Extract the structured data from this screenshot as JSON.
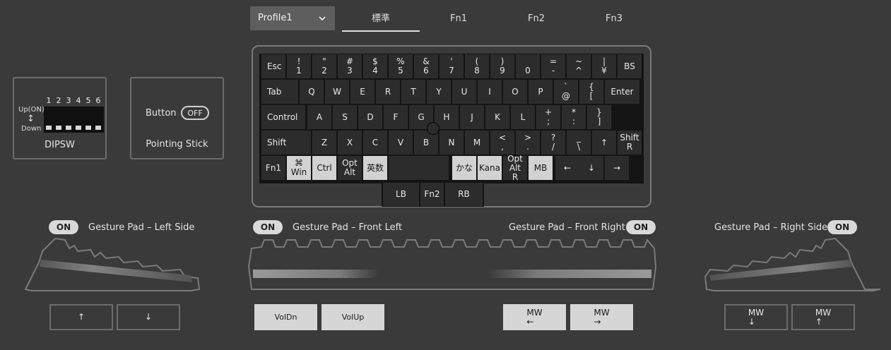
{
  "profile": {
    "selected": "Profile1"
  },
  "tabs": [
    {
      "label": "標準",
      "active": true
    },
    {
      "label": "Fn1",
      "active": false
    },
    {
      "label": "Fn2",
      "active": false
    },
    {
      "label": "Fn3",
      "active": false
    }
  ],
  "dipsw": {
    "title": "DIPSW",
    "up_label": "Up(ON)",
    "arrow": "↕",
    "down_label": "Down",
    "switches": [
      "1",
      "2",
      "3",
      "4",
      "5",
      "6"
    ]
  },
  "pointing_stick": {
    "title": "Pointing Stick",
    "button_label": "Button",
    "toggle": "OFF"
  },
  "keyboard": {
    "row1": [
      "Esc",
      "!\n1",
      "\"\n2",
      "#\n3",
      "$\n4",
      "%\n5",
      "&\n6",
      "'\n7",
      "(\n8",
      ")\n9",
      "\n0",
      "=\n-",
      "~\n^",
      "|\n¥",
      "BS"
    ],
    "row2": [
      "Tab",
      "Q",
      "W",
      "E",
      "R",
      "T",
      "Y",
      "U",
      "I",
      "O",
      "P",
      "`\n@",
      "{\n[",
      "Enter"
    ],
    "row3": [
      "Control",
      "A",
      "S",
      "D",
      "F",
      "G",
      "H",
      "J",
      "K",
      "L",
      "+\n;",
      "*\n:",
      "}\n]"
    ],
    "row4": [
      "Shift",
      "Z",
      "X",
      "C",
      "V",
      "B",
      "N",
      "M",
      "<\n,",
      ">\n.",
      "?\n/",
      "_\n\\",
      "↑",
      "Shift\nR"
    ],
    "row5": [
      "Fn1",
      "⌘\nWin",
      "Ctrl",
      "Opt\nAlt",
      "英数",
      "",
      "かな",
      "Kana",
      "Opt\nAlt\nR",
      "MB",
      "←",
      "↓",
      "→"
    ],
    "row6": [
      "LB",
      "Fn2",
      "RB"
    ]
  },
  "gestures": {
    "left": {
      "state": "ON",
      "label": "Gesture Pad – Left Side",
      "buttons": [
        "↑",
        "↓"
      ]
    },
    "front_left": {
      "state": "ON",
      "label": "Gesture Pad – Front Left",
      "buttons": [
        "VolDn",
        "VolUp"
      ]
    },
    "front_right": {
      "state": "ON",
      "label": "Gesture Pad – Front Right",
      "buttons": [
        "MW\n←",
        "MW\n→"
      ]
    },
    "right": {
      "state": "ON",
      "label": "Gesture Pad – Right Side",
      "buttons": [
        "MW\n↓",
        "MW\n↑"
      ]
    }
  }
}
